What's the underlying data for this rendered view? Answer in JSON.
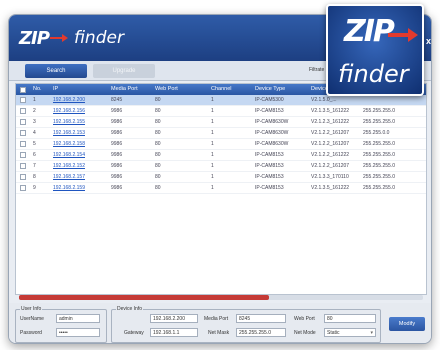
{
  "app": {
    "logo_zip": "ZIP",
    "logo_finder": "finder"
  },
  "toolbar": {
    "search_label": "Search",
    "upgrade_label": "Upgrade",
    "filter_label": "Filtrate"
  },
  "columns": [
    "No.",
    "IP",
    "Media Port",
    "Web Port",
    "Channel",
    "Device Type",
    "Device Version"
  ],
  "rows": [
    {
      "no": "1",
      "ip": "192.168.2.200",
      "media": "8245",
      "web": "80",
      "ch": "1",
      "type": "IP-CAM5300",
      "ver": "V2.1.5.0_...",
      "mask": "",
      "sel": true
    },
    {
      "no": "2",
      "ip": "192.168.2.156",
      "media": "9986",
      "web": "80",
      "ch": "1",
      "type": "IP-CAM8153",
      "ver": "V2.1.3.5_161222",
      "mask": "255.255.255.0"
    },
    {
      "no": "3",
      "ip": "192.168.2.155",
      "media": "9986",
      "web": "80",
      "ch": "1",
      "type": "IP-CAM8630W",
      "ver": "V2.1.2.3_161222",
      "mask": "255.255.255.0"
    },
    {
      "no": "4",
      "ip": "192.168.2.153",
      "media": "9986",
      "web": "80",
      "ch": "1",
      "type": "IP-CAM8630W",
      "ver": "V2.1.2.2_161207",
      "mask": "255.255.0.0"
    },
    {
      "no": "5",
      "ip": "192.168.2.158",
      "media": "9986",
      "web": "80",
      "ch": "1",
      "type": "IP-CAM8630W",
      "ver": "V2.1.2.2_161207",
      "mask": "255.255.255.0"
    },
    {
      "no": "6",
      "ip": "192.168.2.154",
      "media": "9986",
      "web": "80",
      "ch": "1",
      "type": "IP-CAM8153",
      "ver": "V2.1.2.2_161222",
      "mask": "255.255.255.0"
    },
    {
      "no": "7",
      "ip": "192.168.2.152",
      "media": "9986",
      "web": "80",
      "ch": "1",
      "type": "IP-CAM8153",
      "ver": "V2.1.2.2_161207",
      "mask": "255.255.255.0"
    },
    {
      "no": "8",
      "ip": "192.168.2.157",
      "media": "9986",
      "web": "80",
      "ch": "1",
      "type": "IP-CAM8153",
      "ver": "V2.1.3.3_170110",
      "mask": "255.255.255.0"
    },
    {
      "no": "9",
      "ip": "192.168.2.159",
      "media": "9986",
      "web": "80",
      "ch": "1",
      "type": "IP-CAM8153",
      "ver": "V2.1.3.5_161222",
      "mask": "255.255.255.0"
    }
  ],
  "user_info": {
    "title": "User Info",
    "username_label": "UserName",
    "username_value": "admin",
    "password_label": "Password",
    "password_value": "•••••"
  },
  "device_info": {
    "title": "Device Info",
    "ip_value": "192.168.2.200",
    "media_port_label": "Media Port",
    "media_port_value": "8245",
    "web_port_label": "Web Port",
    "web_port_value": "80",
    "gateway_label": "Gateway",
    "gateway_value": "192.168.1.1",
    "netmask_label": "Net Mask",
    "netmask_value": "255.255.255.0",
    "netmode_label": "Net Mode",
    "netmode_value": "Static"
  },
  "modify_label": "Modify",
  "close_glyph": "x",
  "colors": {
    "header_blue": "#2a56a3",
    "selection": "#c5d8f2",
    "accent_red": "#e23a2e"
  }
}
